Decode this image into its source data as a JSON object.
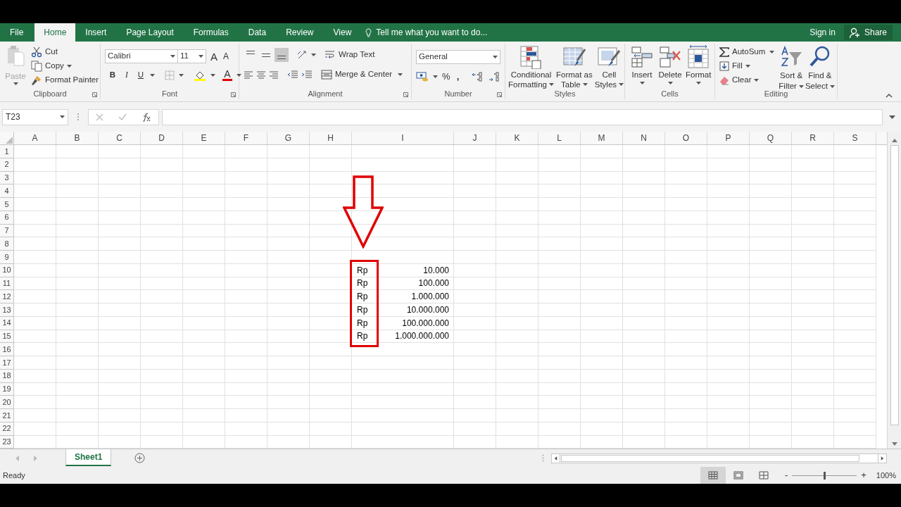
{
  "tabs": [
    {
      "label": "File",
      "selected": false
    },
    {
      "label": "Home",
      "selected": true
    },
    {
      "label": "Insert",
      "selected": false
    },
    {
      "label": "Page Layout",
      "selected": false
    },
    {
      "label": "Formulas",
      "selected": false
    },
    {
      "label": "Data",
      "selected": false
    },
    {
      "label": "Review",
      "selected": false
    },
    {
      "label": "View",
      "selected": false
    }
  ],
  "tell_me": "Tell me what you want to do...",
  "sign_in": "Sign in",
  "share": "Share",
  "ribbon": {
    "clipboard": {
      "label": "Clipboard",
      "paste": {
        "label": "Paste",
        "disabled": true
      },
      "cut": "Cut",
      "copy": "Copy",
      "format_painter": "Format Painter"
    },
    "font": {
      "label": "Font",
      "font_name": "Calibri",
      "font_size": "11",
      "grow": "A",
      "shrink": "A",
      "bold": "B",
      "italic": "I",
      "underline": "U",
      "font_color": "A"
    },
    "alignment": {
      "label": "Alignment",
      "vertical": [
        {
          "selected": false
        },
        {
          "selected": false
        },
        {
          "selected": true
        }
      ],
      "wrap_text": "Wrap Text",
      "merge_center": "Merge & Center"
    },
    "number": {
      "label": "Number",
      "format": "General",
      "percent": "%",
      "comma": ","
    },
    "styles": {
      "label": "Styles",
      "buttons": [
        {
          "kind": "conditional",
          "lines": [
            "Conditional",
            "Formatting"
          ]
        },
        {
          "kind": "table",
          "lines": [
            "Format as",
            "Table"
          ]
        },
        {
          "kind": "cellstyles",
          "lines": [
            "Cell",
            "Styles"
          ]
        }
      ]
    },
    "cells": {
      "label": "Cells",
      "buttons": [
        {
          "kind": "insert",
          "label": "Insert"
        },
        {
          "kind": "delete",
          "label": "Delete"
        },
        {
          "kind": "format",
          "label": "Format"
        }
      ]
    },
    "editing": {
      "label": "Editing",
      "autosum": "AutoSum",
      "fill": "Fill",
      "clear": "Clear",
      "sort": [
        "Sort &",
        "Filter"
      ],
      "find": [
        "Find &",
        "Select"
      ]
    }
  },
  "name_box": "T23",
  "columns": [
    "A",
    "B",
    "C",
    "D",
    "E",
    "F",
    "G",
    "H",
    "I",
    "J",
    "K",
    "L",
    "M",
    "N",
    "O",
    "P",
    "Q",
    "R",
    "S"
  ],
  "rows": [
    {
      "header": "1",
      "framed": false
    },
    {
      "header": "2",
      "framed": false
    },
    {
      "header": "3",
      "framed": false
    },
    {
      "header": "4",
      "framed": false
    },
    {
      "header": "5",
      "framed": false
    },
    {
      "header": "6",
      "framed": false
    },
    {
      "header": "7",
      "framed": false
    },
    {
      "header": "8",
      "framed": false
    },
    {
      "header": "9",
      "framed": false
    },
    {
      "header": "10",
      "currency": "Rp",
      "amount": "10.000",
      "framed": true
    },
    {
      "header": "11",
      "currency": "Rp",
      "amount": "100.000",
      "framed": true
    },
    {
      "header": "12",
      "currency": "Rp",
      "amount": "1.000.000",
      "framed": true
    },
    {
      "header": "13",
      "currency": "Rp",
      "amount": "10.000.000",
      "framed": true
    },
    {
      "header": "14",
      "currency": "Rp",
      "amount": "100.000.000",
      "framed": true
    },
    {
      "header": "15",
      "currency": "Rp",
      "amount": "1.000.000.000",
      "framed": true
    },
    {
      "header": "16",
      "framed": false
    },
    {
      "header": "17",
      "framed": false
    },
    {
      "header": "18",
      "framed": false
    },
    {
      "header": "19",
      "framed": false
    },
    {
      "header": "20",
      "framed": false
    },
    {
      "header": "21",
      "framed": false
    },
    {
      "header": "22",
      "framed": false
    },
    {
      "header": "23",
      "framed": false
    }
  ],
  "annotations": [
    {
      "kind": "arrow"
    }
  ],
  "sheet_tabs": [
    {
      "label": "Sheet1",
      "selected": true
    }
  ],
  "status": "Ready",
  "views": [
    {
      "kind": "normal",
      "selected": true
    },
    {
      "kind": "layout",
      "selected": false
    },
    {
      "kind": "pagebreak",
      "selected": false
    }
  ],
  "zoom": {
    "minus": "-",
    "plus": "+",
    "level": 0.5,
    "reading": "100%"
  }
}
